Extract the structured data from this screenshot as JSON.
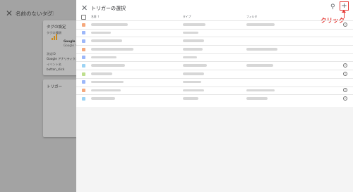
{
  "background": {
    "title": "名前のないタグ",
    "config_card": {
      "heading": "タグの設定",
      "type_label": "タグの種類",
      "tag_name": "Google ア",
      "tag_sub": "Google マーケ",
      "option1_label": "測定ID",
      "option1_value": "Google アナリティクス",
      "option2_label": "イベント名",
      "option2_value": "button_click"
    },
    "trigger_card": {
      "heading": "トリガー"
    }
  },
  "panel": {
    "title": "トリガーの選択",
    "columns": {
      "name": "名前",
      "type": "タイプ",
      "filter": "フィルタ"
    },
    "add_button": "+",
    "annotation": "クリック"
  },
  "icons": {
    "close": "close-icon",
    "folder": "folder-icon",
    "search": "search-icon",
    "add": "plus-icon",
    "info": "info-icon"
  },
  "rows": [
    {
      "color": "#f28b50",
      "info": true
    },
    {
      "color": "#7b9ff7",
      "info": false
    },
    {
      "color": "#7b9ff7",
      "info": false
    },
    {
      "color": "#f28b50",
      "info": false
    },
    {
      "color": "#7b9ff7",
      "info": false
    },
    {
      "color": "#7bc4f0",
      "info": true
    },
    {
      "color": "#a8d468",
      "info": true
    },
    {
      "color": "#7b9ff7",
      "info": false
    },
    {
      "color": "#f28b50",
      "info": true
    },
    {
      "color": "#7bc4f0",
      "info": true
    }
  ],
  "colors": {
    "annotation": "#e53935",
    "overlay": "#a3a3a3"
  }
}
